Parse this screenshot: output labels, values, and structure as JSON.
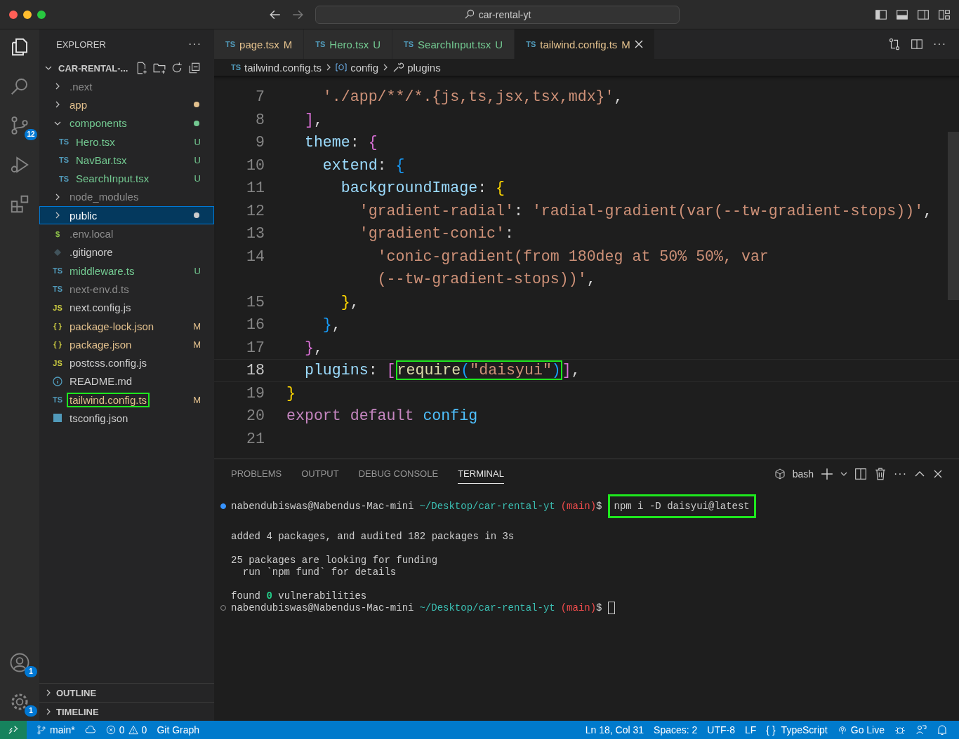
{
  "window": {
    "search": "car-rental-yt"
  },
  "activity_bar": {
    "source_control_badge": "12",
    "accounts_badge": "1",
    "settings_badge": "1"
  },
  "sidebar": {
    "title": "EXPLORER",
    "more": "···",
    "root": {
      "label": "CAR-RENTAL-...",
      "expanded": true
    },
    "items": [
      {
        "name": ".next",
        "kind": "folder",
        "color": "#8c8c8c",
        "expanded": false,
        "selected": false,
        "boxed": false
      },
      {
        "name": "app",
        "kind": "folder",
        "color": "#e2c08d",
        "expanded": false,
        "selected": false,
        "boxed": false,
        "dot": true
      },
      {
        "name": "components",
        "kind": "folder",
        "color": "#73c991",
        "expanded": true,
        "selected": false,
        "boxed": false,
        "dot": true,
        "children": [
          {
            "name": "Hero.tsx",
            "kind": "file",
            "icon": "TS",
            "color": "#73c991",
            "badge": "U",
            "selected": false,
            "boxed": false
          },
          {
            "name": "NavBar.tsx",
            "kind": "file",
            "icon": "TS",
            "color": "#73c991",
            "badge": "U",
            "selected": false,
            "boxed": false
          },
          {
            "name": "SearchInput.tsx",
            "kind": "file",
            "icon": "TS",
            "color": "#73c991",
            "badge": "U",
            "selected": false,
            "boxed": false
          }
        ]
      },
      {
        "name": "node_modules",
        "kind": "folder",
        "color": "#8c8c8c",
        "expanded": false,
        "selected": false,
        "boxed": false
      },
      {
        "name": "public",
        "kind": "folder",
        "expanded": false,
        "selected": true,
        "boxed": false,
        "dot": true
      },
      {
        "name": ".env.local",
        "kind": "file",
        "icon": "$",
        "color": "#8c8c8c",
        "selected": false,
        "boxed": false
      },
      {
        "name": ".gitignore",
        "kind": "git",
        "color": "#cccccc",
        "selected": false,
        "boxed": false
      },
      {
        "name": "middleware.ts",
        "kind": "file",
        "icon": "TS",
        "color": "#73c991",
        "badge": "U",
        "selected": false,
        "boxed": false
      },
      {
        "name": "next-env.d.ts",
        "kind": "file",
        "icon": "TS",
        "color": "#8c8c8c",
        "selected": false,
        "boxed": false
      },
      {
        "name": "next.config.js",
        "kind": "file",
        "icon": "JS",
        "color": "#cccccc",
        "selected": false,
        "boxed": false
      },
      {
        "name": "package-lock.json",
        "kind": "file",
        "icon": "{ }",
        "color": "#e2c08d",
        "badge": "M",
        "selected": false,
        "boxed": false
      },
      {
        "name": "package.json",
        "kind": "file",
        "icon": "{ }",
        "color": "#e2c08d",
        "badge": "M",
        "selected": false,
        "boxed": false
      },
      {
        "name": "postcss.config.js",
        "kind": "file",
        "icon": "JS",
        "color": "#cccccc",
        "selected": false,
        "boxed": false
      },
      {
        "name": "README.md",
        "kind": "info",
        "color": "#cccccc",
        "selected": false,
        "boxed": false
      },
      {
        "name": "tailwind.config.ts",
        "kind": "file",
        "icon": "TS",
        "color": "#e2c08d",
        "badge": "M",
        "selected": false,
        "boxed": true
      },
      {
        "name": "tsconfig.json",
        "kind": "tsconfig",
        "color": "#cccccc",
        "selected": false,
        "boxed": false
      }
    ],
    "sections": [
      {
        "label": "OUTLINE",
        "expanded": false
      },
      {
        "label": "TIMELINE",
        "expanded": false
      }
    ]
  },
  "tabs": [
    {
      "icon": "TS",
      "label": "page.tsx",
      "badge": "M",
      "color": "#e2c08d",
      "selected": false
    },
    {
      "icon": "TS",
      "label": "Hero.tsx",
      "badge": "U",
      "color": "#73c991",
      "selected": false
    },
    {
      "icon": "TS",
      "label": "SearchInput.tsx",
      "badge": "U",
      "color": "#73c991",
      "selected": false
    },
    {
      "icon": "TS",
      "label": "tailwind.config.ts",
      "badge": "M",
      "color": "#e2c08d",
      "selected": true
    }
  ],
  "tab_actions_more": "···",
  "breadcrumb": {
    "icon": "TS",
    "file": "tailwind.config.ts",
    "items": [
      "config",
      "plugins"
    ]
  },
  "editor": {
    "lines": [
      {
        "number": "7",
        "current": false,
        "tokens": [
          {
            "kind": "str",
            "text": "    './app/**/*.{js,ts,jsx,tsx,mdx}'"
          },
          {
            "kind": "punct",
            "text": ","
          }
        ]
      },
      {
        "number": "8",
        "current": false,
        "tokens": [
          {
            "kind": "b2",
            "text": "  ]"
          },
          {
            "kind": "punct",
            "text": ","
          }
        ]
      },
      {
        "number": "9",
        "current": false,
        "tokens": [
          {
            "kind": "prop",
            "text": "  theme"
          },
          {
            "kind": "punct",
            "text": ": "
          },
          {
            "kind": "b2",
            "text": "{"
          }
        ]
      },
      {
        "number": "10",
        "current": false,
        "tokens": [
          {
            "kind": "prop",
            "text": "    extend"
          },
          {
            "kind": "punct",
            "text": ": "
          },
          {
            "kind": "b3",
            "text": "{"
          }
        ]
      },
      {
        "number": "11",
        "current": false,
        "tokens": [
          {
            "kind": "prop",
            "text": "      backgroundImage"
          },
          {
            "kind": "punct",
            "text": ": "
          },
          {
            "kind": "b1",
            "text": "{"
          }
        ]
      },
      {
        "number": "12",
        "current": false,
        "tokens": [
          {
            "kind": "str",
            "text": "        'gradient-radial'"
          },
          {
            "kind": "punct",
            "text": ": "
          },
          {
            "kind": "str",
            "text": "'radial-gradient(var(--tw-gradient-stops))'"
          },
          {
            "kind": "punct",
            "text": ","
          }
        ]
      },
      {
        "number": "13",
        "current": false,
        "tokens": [
          {
            "kind": "str",
            "text": "        'gradient-conic'"
          },
          {
            "kind": "punct",
            "text": ":"
          }
        ]
      },
      {
        "number": "14",
        "current": false,
        "tokens": [
          {
            "kind": "str",
            "text": "          'conic-gradient(from 180deg at 50% 50%, var"
          }
        ]
      },
      {
        "current": false,
        "tokens": [
          {
            "kind": "str",
            "text": "          (--tw-gradient-stops))'"
          },
          {
            "kind": "punct",
            "text": ","
          }
        ]
      },
      {
        "number": "15",
        "current": false,
        "tokens": [
          {
            "kind": "b1",
            "text": "      }"
          },
          {
            "kind": "punct",
            "text": ","
          }
        ]
      },
      {
        "number": "16",
        "current": false,
        "tokens": [
          {
            "kind": "b3",
            "text": "    }"
          },
          {
            "kind": "punct",
            "text": ","
          }
        ]
      },
      {
        "number": "17",
        "current": false,
        "tokens": [
          {
            "kind": "b2",
            "text": "  }"
          },
          {
            "kind": "punct",
            "text": ","
          }
        ]
      },
      {
        "number": "18",
        "current": true,
        "tokens": [
          {
            "kind": "prop",
            "text": "  plugins"
          },
          {
            "kind": "punct",
            "text": ": "
          },
          {
            "kind": "b2",
            "text": "["
          },
          {
            "kind": "group",
            "boxed": true,
            "tokens": [
              {
                "kind": "func",
                "text": "require"
              },
              {
                "kind": "b3",
                "text": "("
              },
              {
                "kind": "str",
                "text": "\"daisyui\""
              },
              {
                "kind": "b3",
                "text": ")"
              }
            ]
          },
          {
            "kind": "b2",
            "text": "]"
          },
          {
            "kind": "punct",
            "text": ","
          }
        ]
      },
      {
        "number": "19",
        "current": false,
        "tokens": [
          {
            "kind": "b1",
            "text": "}"
          }
        ]
      },
      {
        "number": "20",
        "current": false,
        "tokens": [
          {
            "kind": "kw",
            "text": "export default"
          },
          {
            "kind": "var",
            "text": " config"
          }
        ]
      },
      {
        "number": "21",
        "current": false
      }
    ]
  },
  "panel": {
    "tabs": [
      {
        "label": "PROBLEMS",
        "selected": false
      },
      {
        "label": "OUTPUT",
        "selected": false
      },
      {
        "label": "DEBUG CONSOLE",
        "selected": false
      },
      {
        "label": "TERMINAL",
        "selected": true
      }
    ],
    "shell": "bash",
    "more": "···",
    "terminal": [
      {
        "kind": "prompt",
        "done": true,
        "user": "nabendubiswas@Nabendus-Mac-mini",
        "path": "~/Desktop/car-rental-yt",
        "branch": "(main)",
        "sign": "$",
        "command": "npm i -D daisyui@latest",
        "boxed": true
      },
      {
        "kind": "blank"
      },
      {
        "kind": "output",
        "text": "added 4 packages, and audited 182 packages in 3s"
      },
      {
        "kind": "blank"
      },
      {
        "kind": "output",
        "text": "25 packages are looking for funding"
      },
      {
        "kind": "output",
        "text": "  run `npm fund` for details"
      },
      {
        "kind": "blank"
      },
      {
        "kind": "output",
        "text": "found **0** vulnerabilities"
      },
      {
        "kind": "prompt",
        "done": false,
        "user": "nabendubiswas@Nabendus-Mac-mini",
        "path": "~/Desktop/car-rental-yt",
        "branch": "(main)",
        "sign": "$",
        "cursor": true
      }
    ]
  },
  "status_bar": {
    "branch": "main*",
    "errors": "0",
    "warnings": "0",
    "git_graph": "Git Graph",
    "position": "Ln 18, Col 31",
    "spaces": "Spaces: 2",
    "encoding": "UTF-8",
    "eol": "LF",
    "braces": "{ }",
    "language": "TypeScript",
    "go_live": "Go Live"
  }
}
